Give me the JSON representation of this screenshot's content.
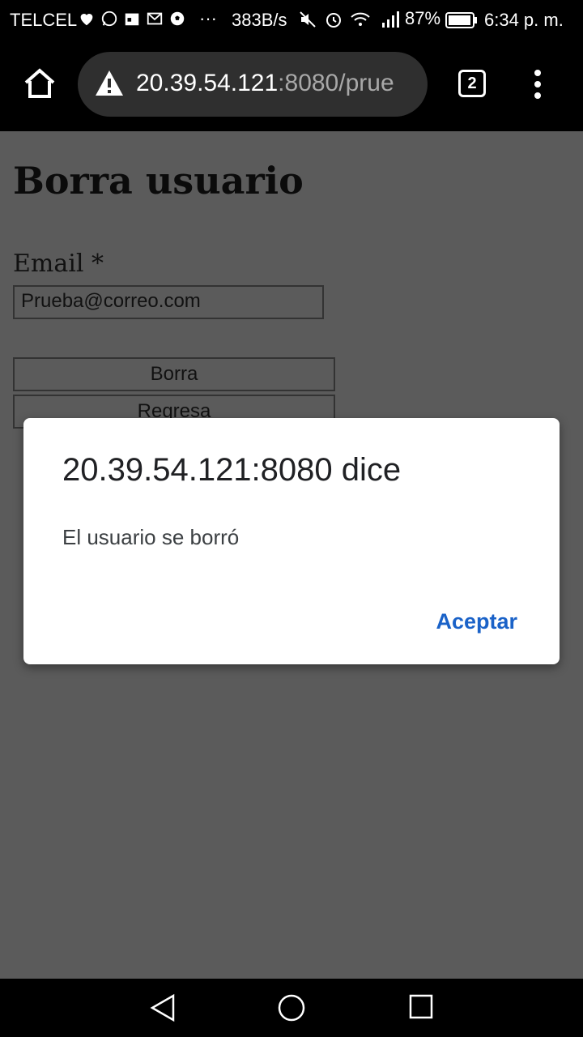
{
  "status_bar": {
    "carrier": "TELCEL",
    "dots": "···",
    "net_speed": "383B/s",
    "battery": "87%",
    "time": "6:34 p. m."
  },
  "browser": {
    "url_host": "20.39.54.121",
    "url_rest": ":8080/prue",
    "tab_count": "2"
  },
  "page": {
    "title": "Borra usuario",
    "email_label": "Email *",
    "email_value": "Prueba@correo.com",
    "delete_button": "Borra",
    "back_button": "Regresa"
  },
  "dialog": {
    "title": "20.39.54.121:8080 dice",
    "message": "El usuario se borró",
    "ok_button": "Aceptar"
  },
  "colors": {
    "page_bg": "#5b5b5b",
    "accent": "#1a62c8"
  }
}
